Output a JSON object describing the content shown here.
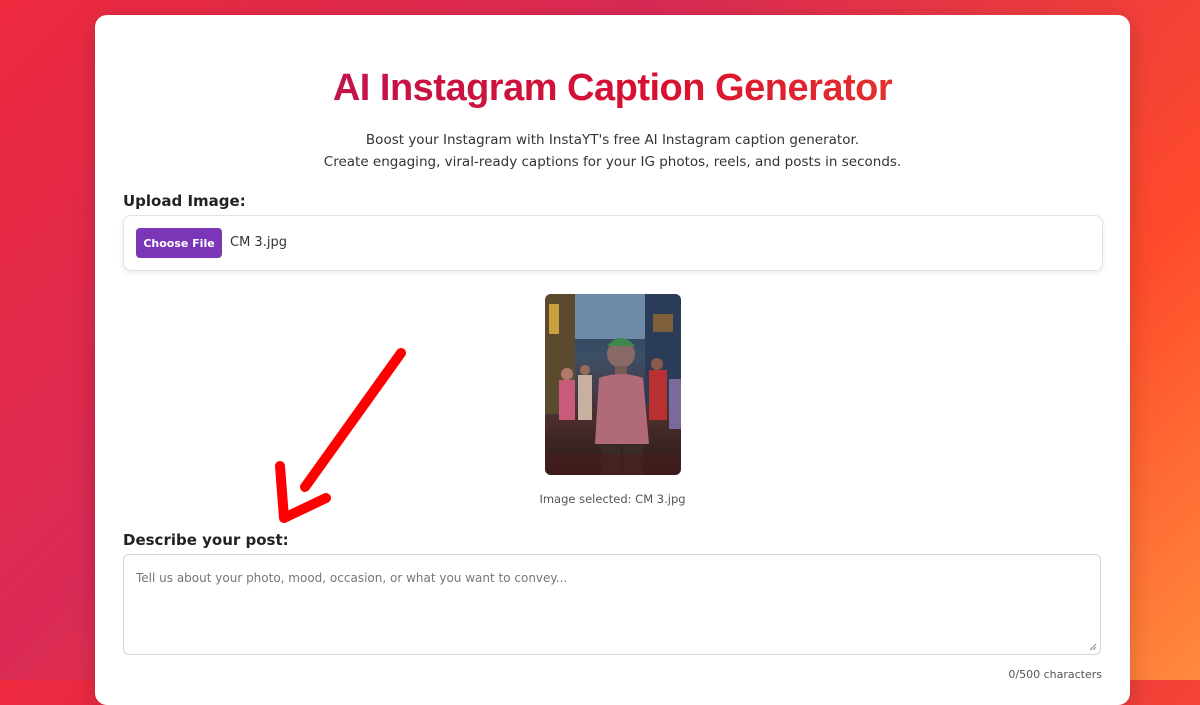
{
  "header": {
    "title": "AI Instagram Caption Generator",
    "subtitle_line1": "Boost your Instagram with InstaYT's free AI Instagram caption generator.",
    "subtitle_line2": "Create engaging, viral-ready captions for your IG photos, reels, and posts in seconds."
  },
  "upload": {
    "label": "Upload Image:",
    "button_label": "Choose File",
    "file_name": "CM 3.jpg",
    "selected_text": "Image selected: CM 3.jpg"
  },
  "description": {
    "label": "Describe your post:",
    "placeholder": "Tell us about your photo, mood, occasion, or what you want to convey...",
    "counter": "0/500 characters"
  },
  "colors": {
    "accent_purple": "#7b35b7",
    "title_gradient_start": "#b3155e",
    "title_gradient_end": "#f0532a",
    "annotation_arrow": "#ff0000"
  },
  "icons": {
    "annotation": "red-arrow-icon",
    "resize": "resize-grip-icon"
  }
}
